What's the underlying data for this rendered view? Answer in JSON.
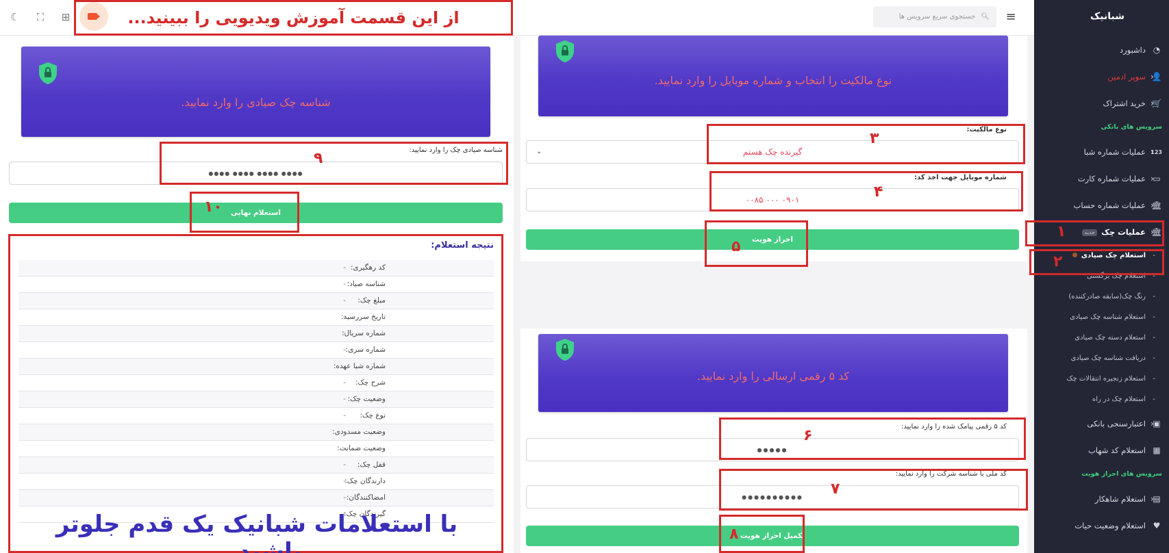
{
  "sidebar": {
    "brand": "شبانیک",
    "items": [
      {
        "label": "داشبورد",
        "icon": "◔"
      },
      {
        "label": "سوپر ادمین",
        "icon": "👤"
      },
      {
        "label": "خرید اشتراک",
        "icon": "🛒"
      }
    ],
    "section_bank": "سرویس های بانکی",
    "bank_items": [
      {
        "label": "عملیات شماره شبا",
        "icon": "123"
      },
      {
        "label": "عملیات شماره کارت",
        "icon": "▭"
      },
      {
        "label": "عملیات شماره حساب",
        "icon": "🏛"
      },
      {
        "label": "عملیات چک",
        "icon": "🏛",
        "badge": "جدید"
      }
    ],
    "check_sub_items": [
      "استعلام چک صیادی",
      "استعلام چک برگشتی",
      "رنگ چک(سابقه صادرکننده)",
      "استعلام شناسه چک صیادی",
      "استعلام دسته چک صیادی",
      "دریافت شناسه چک صیادی",
      "استعلام زنجیره انتقالات چک",
      "استعلام چک در راه"
    ],
    "more_items": [
      {
        "label": "اعتبارسنجی بانکی",
        "icon": "▣"
      },
      {
        "label": "استعلام کد شهاب",
        "icon": "▦"
      }
    ],
    "section_identity": "سرویس های احراز هویت",
    "identity_items": [
      {
        "label": "استعلام شاهکار",
        "icon": "▤"
      },
      {
        "label": "استعلام وضعیت حیات",
        "icon": "♥"
      }
    ]
  },
  "topbar": {
    "search_placeholder": "جستجوی سریع سرویس ها",
    "video_banner": "از این قسمت آموزش ویدیویی را ببینید..."
  },
  "step1": {
    "hero_text": "نوع مالکیت را انتخاب و شماره موبایل را وارد نمایید.",
    "ownership_label": "نوع مالکیت:",
    "ownership_value": "گیرنده چک هستم",
    "mobile_label": "شماره موبایل جهت اخذ کد:",
    "mobile_value": "۰۹۰۱ ۰۰۰ ۰۰۸۵",
    "submit_label": "احراز هویت"
  },
  "step2": {
    "hero_text": "کد ۵ رقمی ارسالی را وارد نمایید.",
    "code_label": "کد ۵ رقمی پیامک شده را وارد نمایید:",
    "code_value": "●●●●●",
    "national_label": "کد ملی یا شناسه شرکت را وارد نمایید:",
    "national_value": "●●●●●●●●●●",
    "submit_label": "تکمیل احراز هویت"
  },
  "step3": {
    "hero_text": "شناسه چک صیادی را وارد نمایید.",
    "sayad_label": "شناسه صیادی چک را وارد نمایید:",
    "sayad_value": "●●●● ●●●● ●●●● ●●●●",
    "submit_label": "استعلام نهایی",
    "result_title": "نتیجه استعلام:",
    "results": [
      {
        "key": "کد رهگیری:",
        "value": "-"
      },
      {
        "key": "شناسه صیاد:",
        "value": "-"
      },
      {
        "key": "مبلغ چک:",
        "value": "-"
      },
      {
        "key": "تاریخ سررسید:",
        "value": "-"
      },
      {
        "key": "شماره سریال:",
        "value": "-"
      },
      {
        "key": "شماره سری:",
        "value": "-"
      },
      {
        "key": "شماره شبا عهده:",
        "value": "-"
      },
      {
        "key": "شرح چک:",
        "value": "-"
      },
      {
        "key": "وضعیت چک:",
        "value": "-"
      },
      {
        "key": "نوع چک:",
        "value": "-"
      },
      {
        "key": "وضعیت مسدودی:",
        "value": "-"
      },
      {
        "key": "وضعیت ضمانت:",
        "value": "-"
      },
      {
        "key": "قفل چک:",
        "value": "-"
      },
      {
        "key": "دارندگان چک:",
        "value": "-"
      },
      {
        "key": "امضاکنندگان:",
        "value": "-"
      },
      {
        "key": "گیرندگان چک:",
        "value": "-"
      }
    ]
  },
  "annotations": {
    "n1": "۱",
    "n2": "۲",
    "n3": "۳",
    "n4": "۴",
    "n5": "۵",
    "n6": "۶",
    "n7": "۷",
    "n8": "۸",
    "n9": "۹",
    "n10": "۱۰",
    "bottom_banner": "با استعلامات شبانیک یک قدم جلوتر باشید..."
  },
  "colors": {
    "sidebar_bg": "#242636",
    "hero_purple": "#5139c7",
    "button_green": "#46cd84",
    "annotation_red": "#d42a2a"
  }
}
